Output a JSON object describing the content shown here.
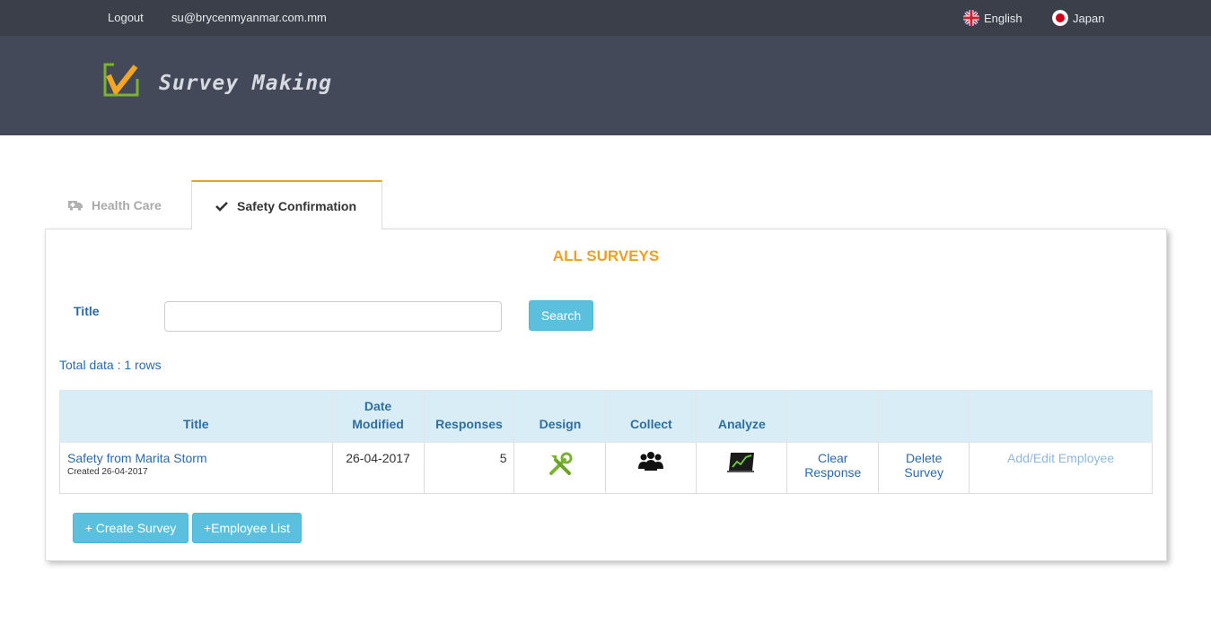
{
  "topbar": {
    "logout_label": "Logout",
    "email": "su@brycenmyanmar.com.mm",
    "languages": [
      {
        "label": "English",
        "icon": "uk-flag-icon"
      },
      {
        "label": "Japan",
        "icon": "japan-flag-icon"
      }
    ]
  },
  "header": {
    "logo_text": "Survey Making",
    "logo_icon": "checkmark-logo-icon"
  },
  "tabs": [
    {
      "label": "Health Care",
      "icon": "ambulance-icon",
      "active": false
    },
    {
      "label": "Safety Confirmation",
      "icon": "check-icon",
      "active": true
    }
  ],
  "main": {
    "heading": "ALL SURVEYS",
    "search": {
      "label": "Title",
      "value": "",
      "placeholder": "",
      "button_label": "Search"
    },
    "total_text": "Total data : 1 rows",
    "table": {
      "columns": [
        "Title",
        "Date Modified",
        "Responses",
        "Design",
        "Collect",
        "Analyze",
        "",
        "",
        ""
      ],
      "rows": [
        {
          "title": "Safety from Marita Storm",
          "created": "Created 26-04-2017",
          "date_modified": "26-04-2017",
          "responses": "5",
          "design_icon": "tools-icon",
          "collect_icon": "people-group-icon",
          "analyze_icon": "chart-monitor-icon",
          "clear_response": "Clear Response",
          "delete_survey": "Delete Survey",
          "add_edit_employee": "Add/Edit Employee"
        }
      ]
    },
    "buttons": {
      "create_survey": "+ Create Survey",
      "employee_list": "+Employee List"
    }
  },
  "colors": {
    "topbar": "#3b3f4a",
    "header": "#434958",
    "accent": "#f0a020",
    "button": "#5bc0de",
    "table_header": "#d9edf7",
    "link": "#2a6ab0"
  }
}
